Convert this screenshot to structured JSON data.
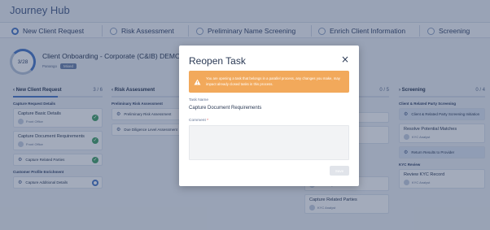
{
  "app": {
    "title": "Journey Hub"
  },
  "steps": [
    {
      "label": "New Client Request",
      "active": true
    },
    {
      "label": "Risk Assessment",
      "active": false
    },
    {
      "label": "Preliminary Name Screening",
      "active": false
    },
    {
      "label": "Enrich Client Information",
      "active": false
    },
    {
      "label": "Screening",
      "active": false
    }
  ],
  "case": {
    "progress_label": "3/28",
    "title": "Client Onboarding - Corporate (C&IB) DEMO",
    "meta_label": "Panango",
    "meta_pill": "Mixed"
  },
  "columns": {
    "new_client": {
      "title": "New Client Request",
      "progress": "3 / 6",
      "progress_fraction": 0.5,
      "group1": "Capture Request Details",
      "cards": [
        {
          "title": "Capture Basic Details",
          "assignee": "Front Office"
        },
        {
          "title": "Capture Document Requirements",
          "assignee": "Front Office"
        }
      ],
      "row_card": "Capture Related Parties",
      "group2": "Customer Profile Enrichment",
      "row_card2": "Capture Additional Details"
    },
    "risk": {
      "title": "Risk Assessment",
      "group1": "Preliminary Risk Assessment",
      "rows": [
        "Preliminary Risk Assessment",
        "Due Diligence Level Assessment"
      ]
    },
    "enrich": {
      "progress": "0 / 5",
      "row1": "Review",
      "card1_title": "esults",
      "card2_assignee": "KYC Analyst",
      "card3_title": "Capture Related Parties",
      "card3_assignee": "KYC Analyst"
    },
    "screening": {
      "title": "Screening",
      "progress": "0 / 4",
      "group1": "Client & Related Party Screening",
      "row1": "Client & Related Party Screening Initiation",
      "card1_title": "Resolve Potential Matches",
      "card1_assignee": "KYC Analyst",
      "row2": "Return Results to Provider",
      "group2": "KYC Review",
      "card2_title": "Review KYC Record",
      "card2_assignee": "KYC Analyst"
    }
  },
  "modal": {
    "title": "Reopen Task",
    "close_icon": "×",
    "warning_text": "You are opening a task that belongs in a parallel process, any changes you make, may impact already closed tasks in this process.",
    "task_name_label": "Task Name",
    "task_name_value": "Capture Document Requirements",
    "comment_label": "Comment",
    "comment_required_mark": "*",
    "comment_value": "",
    "save_label": "Save"
  },
  "colors": {
    "accent": "#4a79c8",
    "warning": "#f2a95b",
    "success": "#45a36a",
    "overlay": "#23375c"
  }
}
